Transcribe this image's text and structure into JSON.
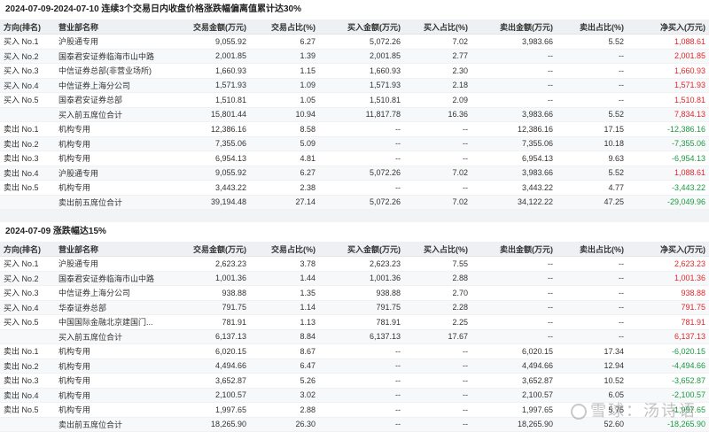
{
  "sections": [
    {
      "title": "2024-07-09-2024-07-10 连续3个交易日内收盘价格涨跌幅偏离值累计达30%",
      "headers": [
        "方向(排名)",
        "营业部名称",
        "交易金额(万元)",
        "交易占比(%)",
        "买入金额(万元)",
        "买入占比(%)",
        "卖出金额(万元)",
        "卖出占比(%)",
        "净买入(万元)"
      ],
      "rows": [
        {
          "dir": "买入 No.1",
          "name": "沪股通专用",
          "amt": "9,055.92",
          "amt_pct": "6.27",
          "buy": "5,072.26",
          "buy_pct": "7.02",
          "sell": "3,983.66",
          "sell_pct": "5.52",
          "net": "1,088.61",
          "sign": "pos"
        },
        {
          "dir": "买入 No.2",
          "name": "国泰君安证券临海市山中路",
          "amt": "2,001.85",
          "amt_pct": "1.39",
          "buy": "2,001.85",
          "buy_pct": "2.77",
          "sell": "--",
          "sell_pct": "--",
          "net": "2,001.85",
          "sign": "pos"
        },
        {
          "dir": "买入 No.3",
          "name": "中信证券总部(非营业场所)",
          "amt": "1,660.93",
          "amt_pct": "1.15",
          "buy": "1,660.93",
          "buy_pct": "2.30",
          "sell": "--",
          "sell_pct": "--",
          "net": "1,660.93",
          "sign": "pos"
        },
        {
          "dir": "买入 No.4",
          "name": "中信证券上海分公司",
          "amt": "1,571.93",
          "amt_pct": "1.09",
          "buy": "1,571.93",
          "buy_pct": "2.18",
          "sell": "--",
          "sell_pct": "--",
          "net": "1,571.93",
          "sign": "pos"
        },
        {
          "dir": "买入 No.5",
          "name": "国泰君安证券总部",
          "amt": "1,510.81",
          "amt_pct": "1.05",
          "buy": "1,510.81",
          "buy_pct": "2.09",
          "sell": "--",
          "sell_pct": "--",
          "net": "1,510.81",
          "sign": "pos"
        },
        {
          "dir": "",
          "name": "买入前五席位合计",
          "amt": "15,801.44",
          "amt_pct": "10.94",
          "buy": "11,817.78",
          "buy_pct": "16.36",
          "sell": "3,983.66",
          "sell_pct": "5.52",
          "net": "7,834.13",
          "sign": "pos"
        },
        {
          "dir": "卖出 No.1",
          "name": "机构专用",
          "amt": "12,386.16",
          "amt_pct": "8.58",
          "buy": "--",
          "buy_pct": "--",
          "sell": "12,386.16",
          "sell_pct": "17.15",
          "net": "-12,386.16",
          "sign": "neg"
        },
        {
          "dir": "卖出 No.2",
          "name": "机构专用",
          "amt": "7,355.06",
          "amt_pct": "5.09",
          "buy": "--",
          "buy_pct": "--",
          "sell": "7,355.06",
          "sell_pct": "10.18",
          "net": "-7,355.06",
          "sign": "neg"
        },
        {
          "dir": "卖出 No.3",
          "name": "机构专用",
          "amt": "6,954.13",
          "amt_pct": "4.81",
          "buy": "--",
          "buy_pct": "--",
          "sell": "6,954.13",
          "sell_pct": "9.63",
          "net": "-6,954.13",
          "sign": "neg"
        },
        {
          "dir": "卖出 No.4",
          "name": "沪股通专用",
          "amt": "9,055.92",
          "amt_pct": "6.27",
          "buy": "5,072.26",
          "buy_pct": "7.02",
          "sell": "3,983.66",
          "sell_pct": "5.52",
          "net": "1,088.61",
          "sign": "pos"
        },
        {
          "dir": "卖出 No.5",
          "name": "机构专用",
          "amt": "3,443.22",
          "amt_pct": "2.38",
          "buy": "--",
          "buy_pct": "--",
          "sell": "3,443.22",
          "sell_pct": "4.77",
          "net": "-3,443.22",
          "sign": "neg"
        },
        {
          "dir": "",
          "name": "卖出前五席位合计",
          "amt": "39,194.48",
          "amt_pct": "27.14",
          "buy": "5,072.26",
          "buy_pct": "7.02",
          "sell": "34,122.22",
          "sell_pct": "47.25",
          "net": "-29,049.96",
          "sign": "neg"
        }
      ]
    },
    {
      "title": "2024-07-09 涨跌幅达15%",
      "headers": [
        "方向(排名)",
        "营业部名称",
        "交易金额(万元)",
        "交易占比(%)",
        "买入金额(万元)",
        "买入占比(%)",
        "卖出金额(万元)",
        "卖出占比(%)",
        "净买入(万元)"
      ],
      "rows": [
        {
          "dir": "买入 No.1",
          "name": "沪股通专用",
          "amt": "2,623.23",
          "amt_pct": "3.78",
          "buy": "2,623.23",
          "buy_pct": "7.55",
          "sell": "--",
          "sell_pct": "--",
          "net": "2,623.23",
          "sign": "pos"
        },
        {
          "dir": "买入 No.2",
          "name": "国泰君安证券临海市山中路",
          "amt": "1,001.36",
          "amt_pct": "1.44",
          "buy": "1,001.36",
          "buy_pct": "2.88",
          "sell": "--",
          "sell_pct": "--",
          "net": "1,001.36",
          "sign": "pos"
        },
        {
          "dir": "买入 No.3",
          "name": "中信证券上海分公司",
          "amt": "938.88",
          "amt_pct": "1.35",
          "buy": "938.88",
          "buy_pct": "2.70",
          "sell": "--",
          "sell_pct": "--",
          "net": "938.88",
          "sign": "pos"
        },
        {
          "dir": "买入 No.4",
          "name": "华泰证券总部",
          "amt": "791.75",
          "amt_pct": "1.14",
          "buy": "791.75",
          "buy_pct": "2.28",
          "sell": "--",
          "sell_pct": "--",
          "net": "791.75",
          "sign": "pos"
        },
        {
          "dir": "买入 No.5",
          "name": "中国国际金融北京建国门...",
          "amt": "781.91",
          "amt_pct": "1.13",
          "buy": "781.91",
          "buy_pct": "2.25",
          "sell": "--",
          "sell_pct": "--",
          "net": "781.91",
          "sign": "pos"
        },
        {
          "dir": "",
          "name": "买入前五席位合计",
          "amt": "6,137.13",
          "amt_pct": "8.84",
          "buy": "6,137.13",
          "buy_pct": "17.67",
          "sell": "--",
          "sell_pct": "--",
          "net": "6,137.13",
          "sign": "pos"
        },
        {
          "dir": "卖出 No.1",
          "name": "机构专用",
          "amt": "6,020.15",
          "amt_pct": "8.67",
          "buy": "--",
          "buy_pct": "--",
          "sell": "6,020.15",
          "sell_pct": "17.34",
          "net": "-6,020.15",
          "sign": "neg"
        },
        {
          "dir": "卖出 No.2",
          "name": "机构专用",
          "amt": "4,494.66",
          "amt_pct": "6.47",
          "buy": "--",
          "buy_pct": "--",
          "sell": "4,494.66",
          "sell_pct": "12.94",
          "net": "-4,494.66",
          "sign": "neg"
        },
        {
          "dir": "卖出 No.3",
          "name": "机构专用",
          "amt": "3,652.87",
          "amt_pct": "5.26",
          "buy": "--",
          "buy_pct": "--",
          "sell": "3,652.87",
          "sell_pct": "10.52",
          "net": "-3,652.87",
          "sign": "neg"
        },
        {
          "dir": "卖出 No.4",
          "name": "机构专用",
          "amt": "2,100.57",
          "amt_pct": "3.02",
          "buy": "--",
          "buy_pct": "--",
          "sell": "2,100.57",
          "sell_pct": "6.05",
          "net": "-2,100.57",
          "sign": "neg"
        },
        {
          "dir": "卖出 No.5",
          "name": "机构专用",
          "amt": "1,997.65",
          "amt_pct": "2.88",
          "buy": "--",
          "buy_pct": "--",
          "sell": "1,997.65",
          "sell_pct": "5.75",
          "net": "-1,997.65",
          "sign": "neg"
        },
        {
          "dir": "",
          "name": "卖出前五席位合计",
          "amt": "18,265.90",
          "amt_pct": "26.30",
          "buy": "--",
          "buy_pct": "--",
          "sell": "18,265.90",
          "sell_pct": "52.60",
          "net": "-18,265.90",
          "sign": "neg"
        }
      ]
    }
  ],
  "watermark": "雪球：汤诗语",
  "colors": {
    "positive": "#e0272b",
    "negative": "#1a9a3f",
    "header_bg": "#eef0f3",
    "gap_bg": "#f2f3f5"
  }
}
